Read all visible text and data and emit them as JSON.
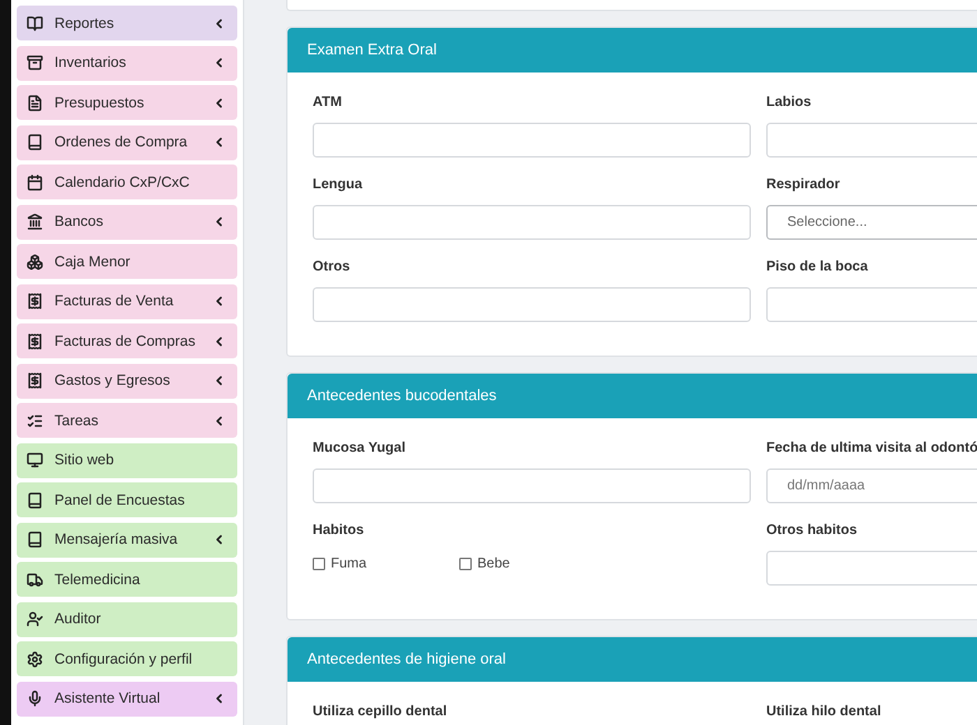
{
  "sidebar": {
    "items": [
      {
        "label": "Reportes",
        "submenu": true,
        "color": "#e2d6ee"
      },
      {
        "label": "Inventarios",
        "submenu": true,
        "color": "#f6d6e7"
      },
      {
        "label": "Presupuestos",
        "submenu": true,
        "color": "#f6d6e7"
      },
      {
        "label": "Ordenes de Compra",
        "submenu": true,
        "color": "#f6d6e7"
      },
      {
        "label": "Calendario CxP/CxC",
        "submenu": false,
        "color": "#f6d6e7"
      },
      {
        "label": "Bancos",
        "submenu": true,
        "color": "#f6d6e7"
      },
      {
        "label": "Caja Menor",
        "submenu": false,
        "color": "#f6d6e7"
      },
      {
        "label": "Facturas de Venta",
        "submenu": true,
        "color": "#f6d6e7"
      },
      {
        "label": "Facturas de Compras",
        "submenu": true,
        "color": "#f6d6e7"
      },
      {
        "label": "Gastos y Egresos",
        "submenu": true,
        "color": "#f6d6e7"
      },
      {
        "label": "Tareas",
        "submenu": true,
        "color": "#f6d6e7"
      },
      {
        "label": "Sitio web",
        "submenu": false,
        "color": "#cfeec4"
      },
      {
        "label": "Panel de Encuestas",
        "submenu": false,
        "color": "#cfeec4"
      },
      {
        "label": "Mensajería masiva",
        "submenu": true,
        "color": "#cfeec4"
      },
      {
        "label": "Telemedicina",
        "submenu": false,
        "color": "#cfeec4"
      },
      {
        "label": "Auditor",
        "submenu": false,
        "color": "#cfeec4"
      },
      {
        "label": "Configuración y perfil",
        "submenu": false,
        "color": "#cfeec4"
      },
      {
        "label": "Asistente Virtual",
        "submenu": true,
        "color": "#edcbf3"
      }
    ]
  },
  "cards": [
    {
      "title": "Examen Extra Oral",
      "fields": [
        {
          "kind": "text",
          "label": "ATM"
        },
        {
          "kind": "text",
          "label": "Labios"
        },
        {
          "kind": "text",
          "label": "Lengua"
        },
        {
          "kind": "select",
          "label": "Respirador",
          "placeholder": "Seleccione..."
        },
        {
          "kind": "text",
          "label": "Otros"
        },
        {
          "kind": "text",
          "label": "Piso de la boca"
        }
      ]
    },
    {
      "title": "Antecedentes bucodentales",
      "fields": [
        {
          "kind": "text",
          "label": "Mucosa Yugal"
        },
        {
          "kind": "date",
          "label": "Fecha de ultima visita al odontó",
          "placeholder": "dd/mm/aaaa"
        },
        {
          "kind": "checks",
          "label": "Habitos",
          "options": [
            {
              "label": "Fuma",
              "checked": false
            },
            {
              "label": "Bebe",
              "checked": false
            }
          ]
        },
        {
          "kind": "text",
          "label": "Otros habitos"
        }
      ]
    },
    {
      "title": "Antecedentes de higiene oral",
      "fields": [
        {
          "kind": "label",
          "label": "Utiliza cepillo dental"
        },
        {
          "kind": "label",
          "label": "Utiliza hilo dental"
        }
      ]
    }
  ]
}
